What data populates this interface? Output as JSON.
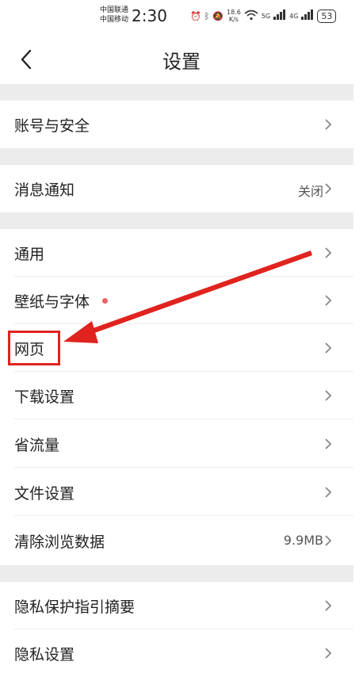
{
  "status_bar": {
    "carrier_1": "中国联通",
    "carrier_2": "中国移动",
    "time": "2:30",
    "speed": "18.6",
    "speed_unit": "K/s",
    "network_1": "5G",
    "network_2": "4G",
    "battery": "53",
    "icons": [
      "alarm-icon",
      "bluetooth-icon",
      "mute-icon",
      "wifi-icon",
      "signal-icon",
      "battery-icon"
    ]
  },
  "header": {
    "title": "设置"
  },
  "rows": {
    "account_security": "账号与安全",
    "notifications": "消息通知",
    "notifications_value": "关闭",
    "general": "通用",
    "wallpaper_font": "壁纸与字体",
    "webpage": "网页",
    "download_settings": "下载设置",
    "data_saver": "省流量",
    "file_settings": "文件设置",
    "clear_browsing_data": "清除浏览数据",
    "clear_browsing_data_value": "9.9MB",
    "privacy_summary": "隐私保护指引摘要",
    "privacy_settings": "隐私设置"
  },
  "colors": {
    "annotation_red": "#e0231e",
    "badge_dot": "#f0616a",
    "divider_gray": "#ececec"
  }
}
